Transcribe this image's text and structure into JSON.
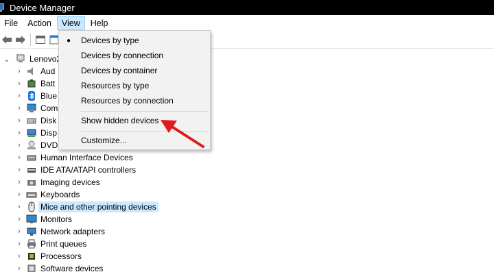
{
  "window": {
    "title": "Device Manager",
    "icon": "device-manager-icon"
  },
  "menubar": {
    "items": [
      "File",
      "Action",
      "View",
      "Help"
    ],
    "active_index": 2
  },
  "toolbar": {
    "buttons": [
      "back-arrow-icon",
      "forward-arrow-icon",
      "properties-icon",
      "help-icon"
    ]
  },
  "tree": {
    "root": {
      "label": "Lenovo2"
    },
    "items": [
      {
        "label": "Aud",
        "icon": "audio-icon"
      },
      {
        "label": "Batt",
        "icon": "battery-icon"
      },
      {
        "label": "Blue",
        "icon": "bluetooth-icon"
      },
      {
        "label": "Com",
        "icon": "computer-icon"
      },
      {
        "label": "Disk",
        "icon": "disk-drive-icon"
      },
      {
        "label": "Disp",
        "icon": "display-adapter-icon"
      },
      {
        "label": "DVD",
        "icon": "dvd-drive-icon"
      },
      {
        "label": "Human Interface Devices",
        "icon": "hid-icon"
      },
      {
        "label": "IDE ATA/ATAPI controllers",
        "icon": "ide-controller-icon"
      },
      {
        "label": "Imaging devices",
        "icon": "camera-icon"
      },
      {
        "label": "Keyboards",
        "icon": "keyboard-icon"
      },
      {
        "label": "Mice and other pointing devices",
        "icon": "mouse-icon",
        "selected": true
      },
      {
        "label": "Monitors",
        "icon": "monitor-icon"
      },
      {
        "label": "Network adapters",
        "icon": "network-adapter-icon"
      },
      {
        "label": "Print queues",
        "icon": "printer-icon"
      },
      {
        "label": "Processors",
        "icon": "processor-icon"
      },
      {
        "label": "Software devices",
        "icon": "software-device-icon"
      }
    ]
  },
  "view_menu": {
    "items": [
      {
        "label": "Devices by type",
        "checked": true
      },
      {
        "label": "Devices by connection",
        "checked": false
      },
      {
        "label": "Devices by container",
        "checked": false
      },
      {
        "label": "Resources by type",
        "checked": false
      },
      {
        "label": "Resources by connection",
        "checked": false
      },
      {
        "label": "Show hidden devices",
        "checked": false
      },
      {
        "label": "Customize...",
        "checked": false
      }
    ],
    "check_glyph": "●"
  },
  "annotation": {
    "arrow_color": "#e01b1b",
    "points_to": "Show hidden devices"
  }
}
